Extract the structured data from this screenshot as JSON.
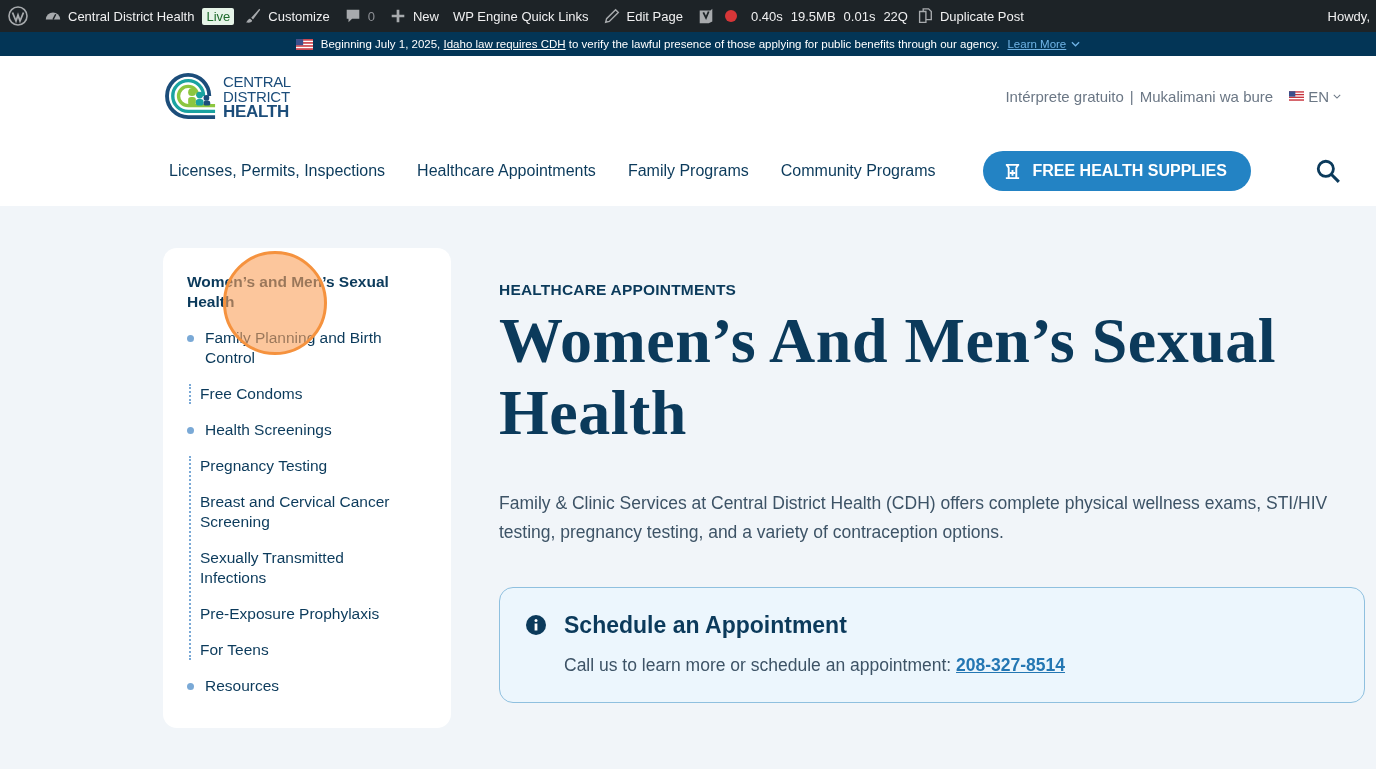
{
  "admin_bar": {
    "items": [
      {
        "kind": "site",
        "label": "Central District Health"
      },
      {
        "kind": "badge",
        "label": "Live"
      },
      {
        "kind": "customize",
        "label": "Customize"
      },
      {
        "kind": "comments",
        "label": "0"
      },
      {
        "kind": "new",
        "label": "New"
      },
      {
        "kind": "link",
        "label": "WP Engine Quick Links"
      },
      {
        "kind": "edit",
        "label": "Edit Page"
      },
      {
        "kind": "seo"
      },
      {
        "kind": "status"
      },
      {
        "kind": "metric",
        "label": "0.40s"
      },
      {
        "kind": "metric",
        "label": "19.5MB"
      },
      {
        "kind": "metric",
        "label": "0.01s"
      },
      {
        "kind": "metric",
        "label": "22Q"
      },
      {
        "kind": "duplicate",
        "label": "Duplicate Post"
      }
    ],
    "greeting": "Howdy,"
  },
  "notice": {
    "before": "Beginning July 1, 2025, ",
    "link": "Idaho law requires CDH",
    "after": " to verify the lawful presence of those applying for public benefits through our agency.",
    "more": "Learn More"
  },
  "header": {
    "logo": [
      "CENTRAL",
      "DISTRICT",
      "HEALTH"
    ],
    "utility": [
      "Intérprete gratuito",
      "|",
      "Mukalimani wa bure"
    ],
    "language": "EN",
    "nav": [
      "Licenses, Permits, Inspections",
      "Healthcare Appointments",
      "Family Programs",
      "Community Programs"
    ],
    "cta": "FREE HEALTH SUPPLIES"
  },
  "sidebar": {
    "title": "Women’s and Men’s Sexual Health",
    "items": [
      {
        "label": "Family Planning and Birth Control",
        "children": [
          {
            "label": "Free Condoms"
          }
        ]
      },
      {
        "label": "Health Screenings",
        "children": [
          {
            "label": "Pregnancy Testing"
          },
          {
            "label": "Breast and Cervical Cancer Screening"
          },
          {
            "label": "Sexually Transmitted Infections"
          },
          {
            "label": "Pre-Exposure Prophylaxis"
          },
          {
            "label": "For Teens"
          }
        ]
      },
      {
        "label": "Resources"
      }
    ]
  },
  "main": {
    "eyebrow": "HEALTHCARE APPOINTMENTS",
    "title": "Women’s And Men’s Sexual Health",
    "intro": "Family & Clinic Services at Central District Health (CDH) offers complete physical wellness exams, STI/HIV testing, pregnancy testing, and a variety of contraception options.",
    "callout": {
      "title": "Schedule an Appointment",
      "text": "Call us to learn more or schedule an appointment: ",
      "phone": "208-327-8514"
    }
  }
}
